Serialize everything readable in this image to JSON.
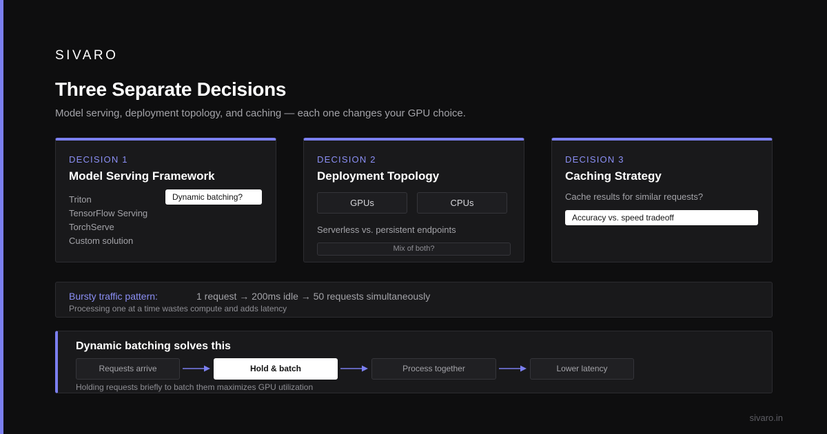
{
  "brand": "SIVARO",
  "title": "Three Separate Decisions",
  "subtitle": "Model serving, deployment topology, and caching — each one changes your GPU choice.",
  "colors": {
    "accent": "#7b7ff0",
    "background": "#0e0e0f",
    "card": "#19191b"
  },
  "decisions": [
    {
      "kicker": "DECISION 1",
      "title": "Model Serving Framework",
      "options": [
        "Triton",
        "TensorFlow Serving",
        "TorchServe",
        "Custom solution"
      ],
      "question": "Dynamic batching?"
    },
    {
      "kicker": "DECISION 2",
      "title": "Deployment Topology",
      "choices": [
        "GPUs",
        "CPUs"
      ],
      "note": "Serverless vs. persistent endpoints",
      "mix": "Mix of both?"
    },
    {
      "kicker": "DECISION 3",
      "title": "Caching Strategy",
      "question": "Cache results for similar requests?",
      "tradeoff": "Accuracy vs. speed tradeoff"
    }
  ],
  "bursty": {
    "label": "Bursty traffic pattern:",
    "flow": "1 request → 200ms idle → 50 requests simultaneously",
    "note": "Processing one at a time wastes compute and adds latency"
  },
  "batching": {
    "title": "Dynamic batching solves this",
    "steps": [
      "Requests arrive",
      "Hold & batch",
      "Process together",
      "Lower latency"
    ],
    "note": "Holding requests briefly to batch them maximizes GPU utilization"
  },
  "footer": "sivaro.in"
}
